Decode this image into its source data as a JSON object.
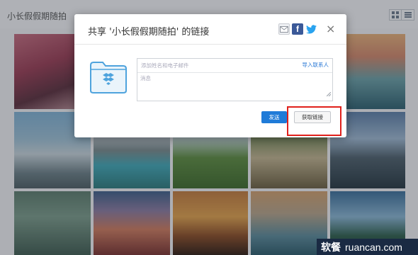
{
  "page": {
    "folder_title": "小长假假期随拍",
    "view_modes": [
      "grid-view-icon",
      "list-view-icon"
    ]
  },
  "dialog": {
    "title": "共享 '小长假假期随拍' 的链接",
    "share_icons": [
      "mail-icon",
      "facebook-icon",
      "twitter-icon"
    ],
    "facebook_glyph": "f",
    "close_label": "×",
    "recipient_placeholder": "添加姓名和电子邮件",
    "import_contacts_label": "导入联系人",
    "message_placeholder": "消息",
    "send_button_label": "发送",
    "get_link_button_label": "获取链接"
  },
  "watermark": {
    "cn": "软餐",
    "en": "ruancan.com"
  },
  "colors": {
    "primary_blue": "#1f7bd8",
    "highlight_red": "#e0201b",
    "dropbox_blue": "#4ea3dd"
  }
}
